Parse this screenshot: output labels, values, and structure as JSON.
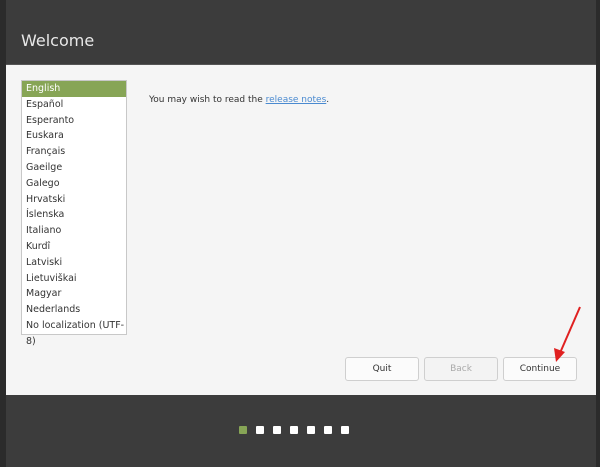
{
  "window": {
    "title": "Welcome"
  },
  "languages": {
    "items": [
      "English",
      "Español",
      "Esperanto",
      "Euskara",
      "Français",
      "Gaeilge",
      "Galego",
      "Hrvatski",
      "Íslenska",
      "Italiano",
      "Kurdî",
      "Latviski",
      "Lietuviškai",
      "Magyar",
      "Nederlands",
      "No localization (UTF-8)"
    ],
    "selected": "English"
  },
  "message": {
    "prefix": "You may wish to read the ",
    "link": "release notes",
    "suffix": "."
  },
  "buttons": {
    "quit": "Quit",
    "back": "Back",
    "continue": "Continue"
  },
  "progress": {
    "total_steps": 7,
    "current_step": 1
  },
  "colors": {
    "accent": "#87a556",
    "annotation_arrow": "#e02020"
  }
}
